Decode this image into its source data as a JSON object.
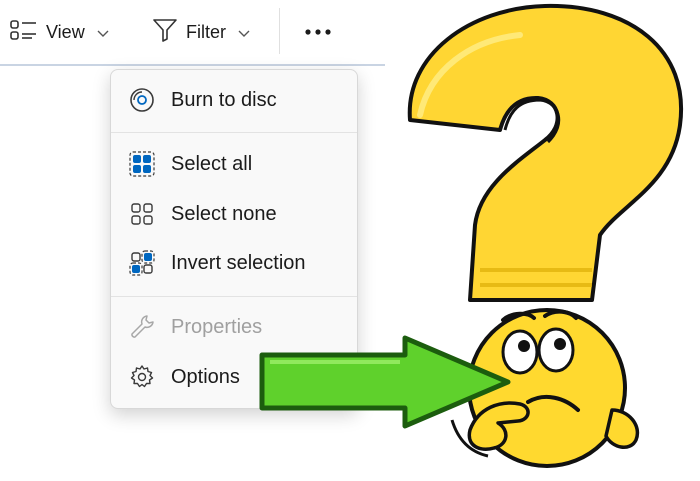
{
  "toolbar": {
    "view_label": "View",
    "filter_label": "Filter",
    "more_icon": "more-horizontal-icon"
  },
  "menu": {
    "items": [
      {
        "label": "Burn to disc",
        "icon": "disc-icon",
        "enabled": true
      },
      {
        "label": "Select all",
        "icon": "select-all-icon",
        "enabled": true
      },
      {
        "label": "Select none",
        "icon": "select-none-icon",
        "enabled": true
      },
      {
        "label": "Invert selection",
        "icon": "invert-selection-icon",
        "enabled": true
      },
      {
        "label": "Properties",
        "icon": "wrench-icon",
        "enabled": false
      },
      {
        "label": "Options",
        "icon": "gear-icon",
        "enabled": true
      }
    ]
  },
  "colors": {
    "accent": "#0067c0",
    "arrow": "#5fd12c",
    "question_mark": "#ffd633",
    "face": "#ffd92f"
  }
}
